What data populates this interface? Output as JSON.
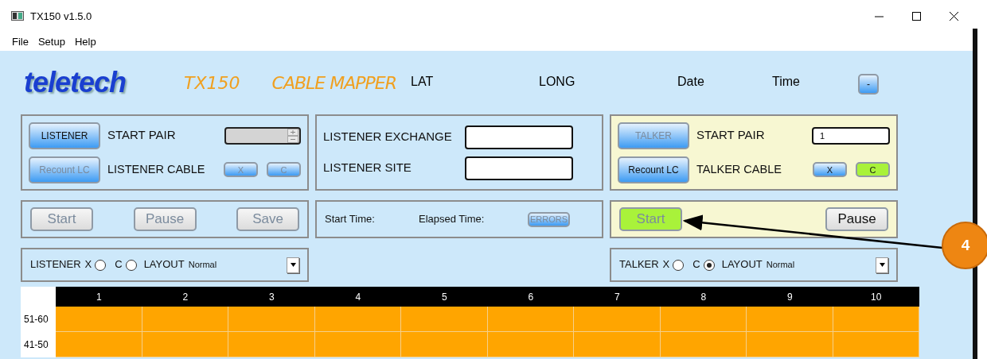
{
  "window": {
    "title": "TX150 v1.5.0"
  },
  "menu": [
    "File",
    "Setup",
    "Help"
  ],
  "header": {
    "logo": "teletech",
    "model": "TX150",
    "product": "CABLE MAPPER",
    "fields": [
      "LAT",
      "LONG",
      "Date",
      "Time"
    ],
    "button": {
      "label": "-",
      "disabled": false
    }
  },
  "listener": {
    "main_button": {
      "label": "LISTENER",
      "disabled": false
    },
    "recount_button": {
      "label": "Recount LC",
      "disabled": true
    },
    "start_pair_label": "START PAIR",
    "start_pair": {
      "disabled": true
    },
    "cable_label": "LISTENER CABLE",
    "cable_buttons": [
      {
        "label": "X",
        "disabled": true,
        "selected": false
      },
      {
        "label": "C",
        "disabled": true,
        "selected": false
      }
    ],
    "actions": [
      {
        "label": "Start",
        "disabled": true,
        "active": false
      },
      {
        "label": "Pause",
        "disabled": true,
        "active": false
      },
      {
        "label": "Save",
        "disabled": true,
        "active": false
      }
    ],
    "options": {
      "label": "LISTENER",
      "radios": [
        {
          "label": "X",
          "selected": false
        },
        {
          "label": "C",
          "selected": false
        }
      ],
      "layout_label": "LAYOUT",
      "layout": "Normal"
    }
  },
  "site": {
    "exchange_label": "LISTENER EXCHANGE",
    "site_label": "LISTENER SITE",
    "start_time": "Start Time:",
    "elapsed_time": "Elapsed Time:",
    "errors_button": {
      "label": "ERRORS",
      "disabled": true
    }
  },
  "talker": {
    "main_button": {
      "label": "TALKER",
      "disabled": true
    },
    "recount_button": {
      "label": "Recount LC",
      "disabled": false
    },
    "start_pair_label": "START PAIR",
    "start_pair": {
      "value": "1",
      "disabled": false
    },
    "cable_label": "TALKER CABLE",
    "cable_buttons": [
      {
        "label": "X",
        "disabled": false,
        "selected": false
      },
      {
        "label": "C",
        "disabled": false,
        "selected": true
      }
    ],
    "actions": [
      {
        "label": "Start",
        "disabled": true,
        "active": true
      },
      {
        "label": "Pause",
        "disabled": false,
        "active": false
      }
    ],
    "options": {
      "label": "TALKER",
      "radios": [
        {
          "label": "X",
          "selected": false
        },
        {
          "label": "C",
          "selected": true
        }
      ],
      "layout_label": "LAYOUT",
      "layout": "Normal"
    }
  },
  "grid": {
    "columns": [
      "1",
      "2",
      "3",
      "4",
      "5",
      "6",
      "7",
      "8",
      "9",
      "10"
    ],
    "rows": [
      "51-60",
      "41-50"
    ]
  },
  "callout": {
    "number": "4"
  }
}
